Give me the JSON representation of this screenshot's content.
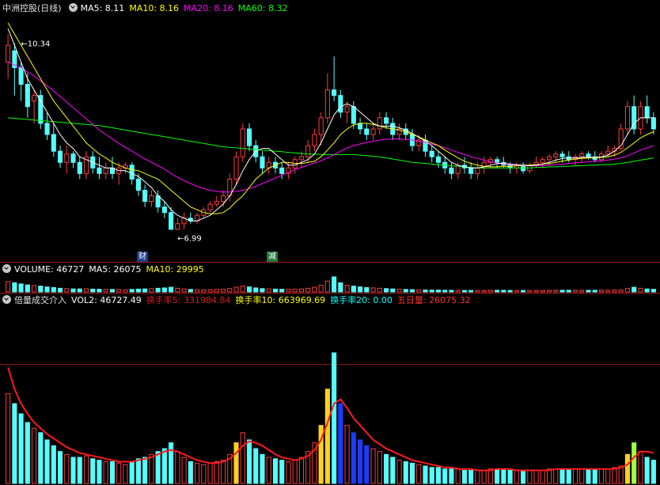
{
  "price_panel": {
    "stock_name": "中洲控股(日线)",
    "ma5": "MA5: 8.11",
    "ma10": "MA10: 8.16",
    "ma20": "MA20: 8.16",
    "ma60": "MA60: 8.32",
    "high_marker": "10.34",
    "low_marker": "6.99",
    "badge_finance": "财",
    "badge_reduce": "减"
  },
  "volume_panel": {
    "label": "VOLUME: 46727",
    "ma5": "MA5: 26075",
    "ma10": "MA10: 29995"
  },
  "indicator_panel": {
    "name": "倍量成交介入",
    "vol2": "VOL2: 46727.49",
    "hs5": "换手率5: 331984.84",
    "hs10": "换手率10: 663969.69",
    "hs20": "换手率20: 0.00",
    "wrl": "五日量: 26075.32"
  },
  "colors": {
    "up": "#ff3c3c",
    "down": "#54ffff",
    "ma5": "#ffffff",
    "ma10": "#ffff00",
    "ma20": "#ff00ff",
    "ma60": "#00ff00",
    "grid": "#a01818"
  },
  "chart_data": {
    "type": "candlestick",
    "ylim": [
      6.6,
      10.8
    ],
    "ohlc": [
      [
        10.0,
        10.5,
        9.7,
        10.3
      ],
      [
        10.2,
        10.34,
        9.4,
        9.9
      ],
      [
        9.9,
        10.0,
        9.3,
        9.6
      ],
      [
        9.6,
        9.8,
        9.0,
        9.2
      ],
      [
        9.3,
        9.5,
        8.9,
        9.4
      ],
      [
        9.4,
        9.5,
        8.8,
        8.9
      ],
      [
        8.9,
        9.1,
        8.6,
        8.7
      ],
      [
        8.7,
        8.9,
        8.3,
        8.4
      ],
      [
        8.4,
        8.5,
        8.1,
        8.2
      ],
      [
        8.2,
        8.5,
        8.0,
        8.35
      ],
      [
        8.35,
        8.4,
        8.1,
        8.2
      ],
      [
        8.2,
        8.3,
        7.9,
        8.0
      ],
      [
        8.0,
        8.4,
        7.9,
        8.3
      ],
      [
        8.3,
        8.4,
        8.0,
        8.1
      ],
      [
        8.1,
        8.3,
        7.9,
        8.0
      ],
      [
        8.0,
        8.2,
        7.9,
        8.1
      ],
      [
        8.1,
        8.3,
        7.9,
        8.0
      ],
      [
        8.0,
        8.2,
        7.8,
        8.1
      ],
      [
        8.1,
        8.2,
        8.0,
        8.15
      ],
      [
        8.15,
        8.2,
        7.8,
        7.9
      ],
      [
        7.9,
        8.0,
        7.6,
        7.7
      ],
      [
        7.7,
        7.8,
        7.4,
        7.5
      ],
      [
        7.5,
        7.7,
        7.4,
        7.6
      ],
      [
        7.6,
        7.7,
        7.3,
        7.4
      ],
      [
        7.4,
        7.5,
        7.2,
        7.3
      ],
      [
        7.3,
        7.4,
        6.99,
        7.0
      ],
      [
        7.0,
        7.2,
        6.99,
        7.1
      ],
      [
        7.1,
        7.3,
        7.0,
        7.2
      ],
      [
        7.2,
        7.3,
        7.1,
        7.15
      ],
      [
        7.15,
        7.3,
        7.1,
        7.25
      ],
      [
        7.25,
        7.4,
        7.2,
        7.35
      ],
      [
        7.35,
        7.5,
        7.3,
        7.45
      ],
      [
        7.45,
        7.6,
        7.4,
        7.5
      ],
      [
        7.5,
        7.7,
        7.4,
        7.6
      ],
      [
        7.6,
        8.0,
        7.5,
        7.9
      ],
      [
        7.9,
        8.4,
        7.8,
        8.3
      ],
      [
        8.3,
        8.9,
        8.2,
        8.8
      ],
      [
        8.8,
        8.9,
        8.4,
        8.5
      ],
      [
        8.5,
        8.6,
        8.2,
        8.3
      ],
      [
        8.3,
        8.4,
        8.0,
        8.1
      ],
      [
        8.1,
        8.3,
        8.0,
        8.2
      ],
      [
        8.2,
        8.3,
        8.0,
        8.1
      ],
      [
        8.1,
        8.2,
        7.9,
        8.0
      ],
      [
        8.0,
        8.2,
        7.9,
        8.1
      ],
      [
        8.1,
        8.3,
        8.0,
        8.25
      ],
      [
        8.25,
        8.4,
        8.1,
        8.3
      ],
      [
        8.3,
        8.6,
        8.2,
        8.5
      ],
      [
        8.5,
        8.8,
        8.4,
        8.7
      ],
      [
        8.7,
        9.1,
        8.5,
        9.0
      ],
      [
        9.0,
        9.8,
        8.9,
        9.5
      ],
      [
        9.5,
        10.1,
        9.3,
        9.4
      ],
      [
        9.4,
        9.5,
        9.0,
        9.1
      ],
      [
        9.1,
        9.3,
        8.9,
        9.2
      ],
      [
        9.2,
        9.3,
        8.8,
        8.9
      ],
      [
        8.9,
        9.0,
        8.7,
        8.8
      ],
      [
        8.8,
        8.9,
        8.6,
        8.7
      ],
      [
        8.7,
        8.9,
        8.6,
        8.8
      ],
      [
        8.8,
        9.1,
        8.7,
        9.0
      ],
      [
        9.0,
        9.1,
        8.8,
        8.9
      ],
      [
        8.9,
        9.0,
        8.6,
        8.7
      ],
      [
        8.7,
        8.9,
        8.6,
        8.8
      ],
      [
        8.8,
        8.9,
        8.6,
        8.7
      ],
      [
        8.7,
        8.8,
        8.4,
        8.5
      ],
      [
        8.5,
        8.7,
        8.4,
        8.6
      ],
      [
        8.6,
        8.7,
        8.3,
        8.4
      ],
      [
        8.4,
        8.5,
        8.2,
        8.3
      ],
      [
        8.3,
        8.4,
        8.1,
        8.2
      ],
      [
        8.2,
        8.3,
        8.0,
        8.1
      ],
      [
        8.1,
        8.2,
        7.9,
        8.0
      ],
      [
        8.0,
        8.2,
        7.9,
        8.15
      ],
      [
        8.15,
        8.3,
        8.0,
        8.1
      ],
      [
        8.1,
        8.2,
        7.9,
        8.0
      ],
      [
        8.0,
        8.2,
        7.9,
        8.1
      ],
      [
        8.1,
        8.3,
        8.0,
        8.2
      ],
      [
        8.2,
        8.3,
        8.1,
        8.25
      ],
      [
        8.25,
        8.3,
        8.1,
        8.2
      ],
      [
        8.2,
        8.3,
        8.1,
        8.15
      ],
      [
        8.15,
        8.2,
        8.0,
        8.1
      ],
      [
        8.1,
        8.2,
        8.0,
        8.15
      ],
      [
        8.15,
        8.2,
        8.0,
        8.05
      ],
      [
        8.05,
        8.2,
        8.0,
        8.15
      ],
      [
        8.15,
        8.3,
        8.1,
        8.2
      ],
      [
        8.2,
        8.3,
        8.1,
        8.25
      ],
      [
        8.25,
        8.35,
        8.15,
        8.3
      ],
      [
        8.3,
        8.4,
        8.2,
        8.35
      ],
      [
        8.35,
        8.4,
        8.2,
        8.3
      ],
      [
        8.3,
        8.4,
        8.2,
        8.25
      ],
      [
        8.25,
        8.35,
        8.15,
        8.3
      ],
      [
        8.3,
        8.4,
        8.2,
        8.35
      ],
      [
        8.35,
        8.4,
        8.25,
        8.3
      ],
      [
        8.3,
        8.4,
        8.2,
        8.25
      ],
      [
        8.25,
        8.4,
        8.2,
        8.35
      ],
      [
        8.35,
        8.5,
        8.3,
        8.4
      ],
      [
        8.4,
        8.5,
        8.3,
        8.45
      ],
      [
        8.45,
        8.9,
        8.4,
        8.8
      ],
      [
        8.8,
        9.3,
        8.7,
        9.2
      ],
      [
        9.2,
        9.4,
        8.7,
        8.8
      ],
      [
        8.8,
        9.3,
        8.7,
        9.2
      ],
      [
        9.2,
        9.4,
        8.9,
        9.0
      ],
      [
        9.0,
        9.1,
        8.7,
        8.8
      ]
    ],
    "ma5": [
      10.6,
      10.3,
      10.0,
      9.7,
      9.5,
      9.3,
      9.1,
      8.9,
      8.7,
      8.55,
      8.45,
      8.3,
      8.25,
      8.2,
      8.15,
      8.1,
      8.1,
      8.05,
      8.05,
      8.0,
      7.95,
      7.85,
      7.75,
      7.6,
      7.5,
      7.35,
      7.25,
      7.2,
      7.15,
      7.15,
      7.2,
      7.25,
      7.35,
      7.45,
      7.6,
      7.8,
      8.05,
      8.25,
      8.4,
      8.45,
      8.45,
      8.35,
      8.25,
      8.15,
      8.15,
      8.2,
      8.25,
      8.35,
      8.55,
      8.8,
      9.05,
      9.2,
      9.25,
      9.2,
      9.1,
      9.0,
      8.9,
      8.85,
      8.85,
      8.85,
      8.82,
      8.78,
      8.72,
      8.65,
      8.58,
      8.5,
      8.4,
      8.3,
      8.2,
      8.15,
      8.12,
      8.1,
      8.1,
      8.12,
      8.15,
      8.18,
      8.18,
      8.17,
      8.16,
      8.15,
      8.14,
      8.15,
      8.17,
      8.2,
      8.24,
      8.27,
      8.28,
      8.28,
      8.29,
      8.29,
      8.29,
      8.3,
      8.33,
      8.4,
      8.5,
      8.7,
      8.9,
      9.0,
      9.0,
      9.0
    ],
    "ma10": [
      10.7,
      10.5,
      10.3,
      10.1,
      9.9,
      9.7,
      9.5,
      9.3,
      9.15,
      9.0,
      8.85,
      8.7,
      8.55,
      8.45,
      8.35,
      8.28,
      8.2,
      8.15,
      8.1,
      8.07,
      8.05,
      8.0,
      7.95,
      7.9,
      7.8,
      7.7,
      7.6,
      7.5,
      7.4,
      7.35,
      7.3,
      7.28,
      7.28,
      7.3,
      7.38,
      7.5,
      7.6,
      7.75,
      7.9,
      8.0,
      8.1,
      8.15,
      8.2,
      8.2,
      8.18,
      8.18,
      8.2,
      8.22,
      8.3,
      8.42,
      8.55,
      8.7,
      8.8,
      8.87,
      8.9,
      8.9,
      8.88,
      8.85,
      8.82,
      8.8,
      8.78,
      8.75,
      8.7,
      8.66,
      8.6,
      8.55,
      8.5,
      8.42,
      8.35,
      8.28,
      8.22,
      8.18,
      8.15,
      8.13,
      8.12,
      8.12,
      8.13,
      8.13,
      8.14,
      8.15,
      8.15,
      8.16,
      8.17,
      8.18,
      8.2,
      8.22,
      8.24,
      8.26,
      8.27,
      8.28,
      8.28,
      8.29,
      8.3,
      8.33,
      8.38,
      8.46,
      8.55,
      8.64,
      8.7,
      8.75
    ],
    "ma20": [
      10.0,
      9.95,
      9.9,
      9.82,
      9.75,
      9.66,
      9.57,
      9.48,
      9.38,
      9.28,
      9.18,
      9.08,
      8.98,
      8.88,
      8.78,
      8.7,
      8.62,
      8.54,
      8.47,
      8.4,
      8.33,
      8.26,
      8.2,
      8.14,
      8.08,
      8.0,
      7.93,
      7.87,
      7.82,
      7.77,
      7.73,
      7.7,
      7.68,
      7.67,
      7.67,
      7.68,
      7.7,
      7.73,
      7.77,
      7.82,
      7.87,
      7.92,
      7.97,
      8.02,
      8.07,
      8.11,
      8.15,
      8.19,
      8.23,
      8.28,
      8.34,
      8.4,
      8.46,
      8.5,
      8.53,
      8.56,
      8.58,
      8.6,
      8.61,
      8.62,
      8.62,
      8.61,
      8.6,
      8.58,
      8.56,
      8.53,
      8.5,
      8.46,
      8.42,
      8.38,
      8.34,
      8.3,
      8.27,
      8.24,
      8.21,
      8.19,
      8.17,
      8.16,
      8.15,
      8.14,
      8.14,
      8.14,
      8.14,
      8.15,
      8.16,
      8.17,
      8.18,
      8.19,
      8.2,
      8.21,
      8.22,
      8.23,
      8.24,
      8.26,
      8.28,
      8.32,
      8.37,
      8.42,
      8.46,
      8.5
    ],
    "ma60": [
      9.0,
      8.99,
      8.98,
      8.97,
      8.96,
      8.95,
      8.94,
      8.93,
      8.92,
      8.91,
      8.9,
      8.89,
      8.88,
      8.87,
      8.86,
      8.84,
      8.82,
      8.8,
      8.78,
      8.76,
      8.74,
      8.72,
      8.7,
      8.68,
      8.66,
      8.64,
      8.62,
      8.6,
      8.58,
      8.56,
      8.54,
      8.52,
      8.5,
      8.48,
      8.47,
      8.46,
      8.45,
      8.44,
      8.43,
      8.42,
      8.41,
      8.4,
      8.39,
      8.38,
      8.37,
      8.36,
      8.35,
      8.35,
      8.34,
      8.34,
      8.34,
      8.34,
      8.34,
      8.34,
      8.33,
      8.32,
      8.31,
      8.3,
      8.28,
      8.26,
      8.24,
      8.22,
      8.2,
      8.19,
      8.18,
      8.17,
      8.16,
      8.15,
      8.14,
      8.13,
      8.12,
      8.11,
      8.1,
      8.1,
      8.1,
      8.1,
      8.1,
      8.1,
      8.1,
      8.1,
      8.1,
      8.11,
      8.11,
      8.12,
      8.12,
      8.13,
      8.13,
      8.14,
      8.14,
      8.15,
      8.15,
      8.16,
      8.16,
      8.17,
      8.18,
      8.2,
      8.22,
      8.24,
      8.26,
      8.28
    ],
    "volume": [
      62,
      55,
      48,
      42,
      38,
      35,
      30,
      26,
      22,
      20,
      18,
      18,
      19,
      17,
      16,
      15,
      15,
      14,
      13,
      15,
      17,
      18,
      20,
      22,
      24,
      28,
      22,
      18,
      15,
      14,
      13,
      14,
      15,
      16,
      20,
      28,
      35,
      30,
      24,
      20,
      18,
      17,
      16,
      15,
      16,
      18,
      22,
      28,
      40,
      65,
      90,
      55,
      40,
      35,
      30,
      26,
      24,
      22,
      20,
      18,
      16,
      15,
      14,
      13,
      12,
      11,
      11,
      10,
      10,
      10,
      9,
      9,
      9,
      9,
      10,
      10,
      10,
      9,
      9,
      9,
      9,
      9,
      9,
      10,
      10,
      10,
      10,
      10,
      10,
      10,
      10,
      10,
      10,
      11,
      12,
      20,
      28,
      22,
      18,
      16
    ],
    "vol_ylim": [
      0,
      120
    ],
    "wrl": [
      80,
      65,
      55,
      48,
      42,
      38,
      34,
      31,
      28,
      25,
      23,
      21,
      20,
      19,
      18,
      17,
      16,
      15,
      15,
      15,
      16,
      17,
      18,
      20,
      22,
      23,
      22,
      20,
      18,
      16,
      15,
      14,
      14,
      15,
      17,
      21,
      26,
      29,
      28,
      26,
      23,
      20,
      18,
      17,
      16,
      17,
      19,
      23,
      30,
      42,
      55,
      58,
      52,
      45,
      40,
      35,
      30,
      27,
      24,
      22,
      20,
      18,
      16,
      15,
      14,
      13,
      12,
      11,
      11,
      10,
      10,
      10,
      9,
      9,
      9,
      10,
      10,
      10,
      9,
      9,
      9,
      9,
      9,
      9,
      10,
      10,
      10,
      10,
      10,
      10,
      10,
      10,
      10,
      10,
      11,
      13,
      18,
      22,
      22,
      21
    ]
  }
}
